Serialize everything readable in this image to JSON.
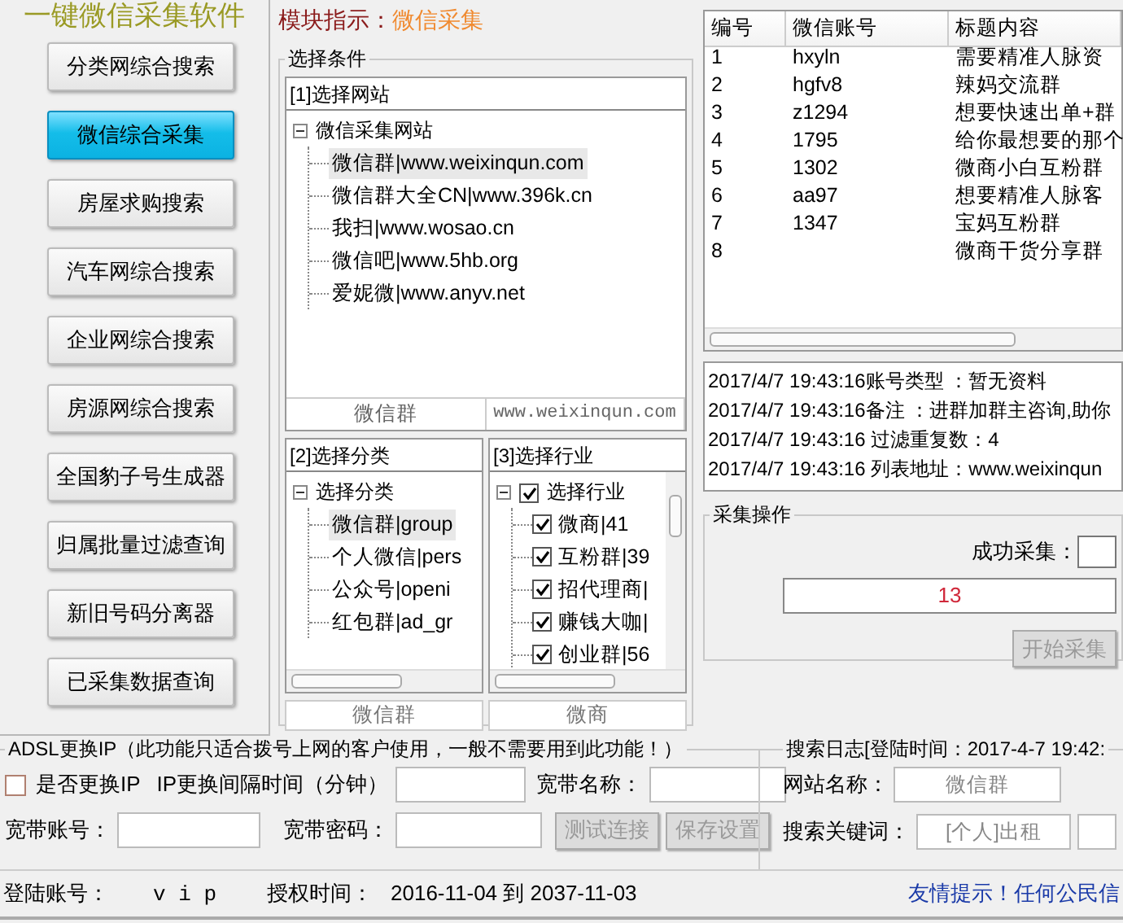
{
  "app_title": "一键微信采集软件",
  "sidebar": {
    "items": [
      {
        "label": "分类网综合搜索",
        "selected": false
      },
      {
        "label": "微信综合采集",
        "selected": true
      },
      {
        "label": "房屋求购搜索",
        "selected": false
      },
      {
        "label": "汽车网综合搜索",
        "selected": false
      },
      {
        "label": "企业网综合搜索",
        "selected": false
      },
      {
        "label": "房源网综合搜索",
        "selected": false
      },
      {
        "label": "全国豹子号生成器",
        "selected": false
      },
      {
        "label": "归属批量过滤查询",
        "selected": false
      },
      {
        "label": "新旧号码分离器",
        "selected": false
      },
      {
        "label": "已采集数据查询",
        "selected": false
      }
    ]
  },
  "module": {
    "label": "模块指示：",
    "value": "微信采集"
  },
  "conditions": {
    "legend": "选择条件",
    "site_panel": {
      "title": "[1]选择网站",
      "root": {
        "label": "微信采集网站",
        "expanded": true,
        "children": [
          {
            "label": "微信群|www.weixinqun.com",
            "selected": true
          },
          {
            "label": "微信群大全CN|www.396k.cn",
            "selected": false
          },
          {
            "label": "我扫|www.wosao.cn",
            "selected": false
          },
          {
            "label": "微信吧|www.5hb.org",
            "selected": false
          },
          {
            "label": "爱妮微|www.anyv.net",
            "selected": false
          }
        ]
      },
      "footer": [
        "微信群",
        "www.weixinqun.com"
      ]
    },
    "category_panel": {
      "title": "[2]选择分类",
      "root": {
        "label": "选择分类",
        "expanded": true,
        "children": [
          {
            "label": "微信群|group",
            "selected": true
          },
          {
            "label": "个人微信|pers",
            "selected": false
          },
          {
            "label": "公众号|openi",
            "selected": false
          },
          {
            "label": "红包群|ad_gr",
            "selected": false
          }
        ]
      },
      "footer": "微信群"
    },
    "industry_panel": {
      "title": "[3]选择行业",
      "root": {
        "label": "选择行业",
        "expanded": true,
        "checked": true,
        "children": [
          {
            "label": "微商|41",
            "checked": true
          },
          {
            "label": "互粉群|39",
            "checked": true
          },
          {
            "label": "招代理商|",
            "checked": true
          },
          {
            "label": "赚钱大咖|",
            "checked": true
          },
          {
            "label": "创业群|56",
            "checked": true
          }
        ]
      },
      "footer": "微商"
    }
  },
  "table": {
    "columns": [
      "编号",
      "微信账号",
      "标题内容"
    ],
    "rows": [
      [
        "1",
        "hxyln",
        "需要精准人脉资"
      ],
      [
        "2",
        "hgfv8",
        "辣妈交流群"
      ],
      [
        "3",
        "z1294",
        "想要快速出单+群"
      ],
      [
        "4",
        "1795",
        "给你最想要的那个"
      ],
      [
        "5",
        "1302",
        "微商小白互粉群"
      ],
      [
        "6",
        "aa97",
        "想要精准人脉客"
      ],
      [
        "7",
        "1347",
        "宝妈互粉群"
      ],
      [
        "8",
        "",
        "微商干货分享群"
      ]
    ]
  },
  "log": [
    "2017/4/7 19:43:16账号类型 ：暂无资料",
    "2017/4/7 19:43:16备注 ：进群加群主咨询,助你",
    "2017/4/7 19:43:16 过滤重复数：4",
    "2017/4/7 19:43:16 列表地址：www.weixinqun"
  ],
  "collect": {
    "legend": "采集操作",
    "success_label": "成功采集：",
    "count": "13",
    "start_button": {
      "label": "开始采集",
      "disabled": true
    }
  },
  "adsl": {
    "legend": "ADSL更换IP（此功能只适合拨号上网的客户使用，一般不需要用到此功能！）",
    "change_ip": {
      "label": "是否更换IP",
      "checked": false
    },
    "interval_label": "IP更换间隔时间（分钟）",
    "name_label": "宽带名称：",
    "account_label": "宽带账号：",
    "password_label": "宽带密码：",
    "buttons": [
      {
        "label": "测试连接",
        "disabled": true
      },
      {
        "label": "保存设置",
        "disabled": true
      }
    ]
  },
  "search_log": {
    "legend": "搜索日志[登陆时间：2017-4-7 19:42:",
    "site_label": "网站名称：",
    "site_value": "微信群",
    "keyword_label": "搜索关键词：",
    "keyword_value": "[个人]出租"
  },
  "status_bar": {
    "account_label": "登陆账号：",
    "account": "v i p",
    "license_label": "授权时间：",
    "license": "2016-11-04 到 2037-11-03",
    "notice": "友情提示！任何公民信"
  }
}
